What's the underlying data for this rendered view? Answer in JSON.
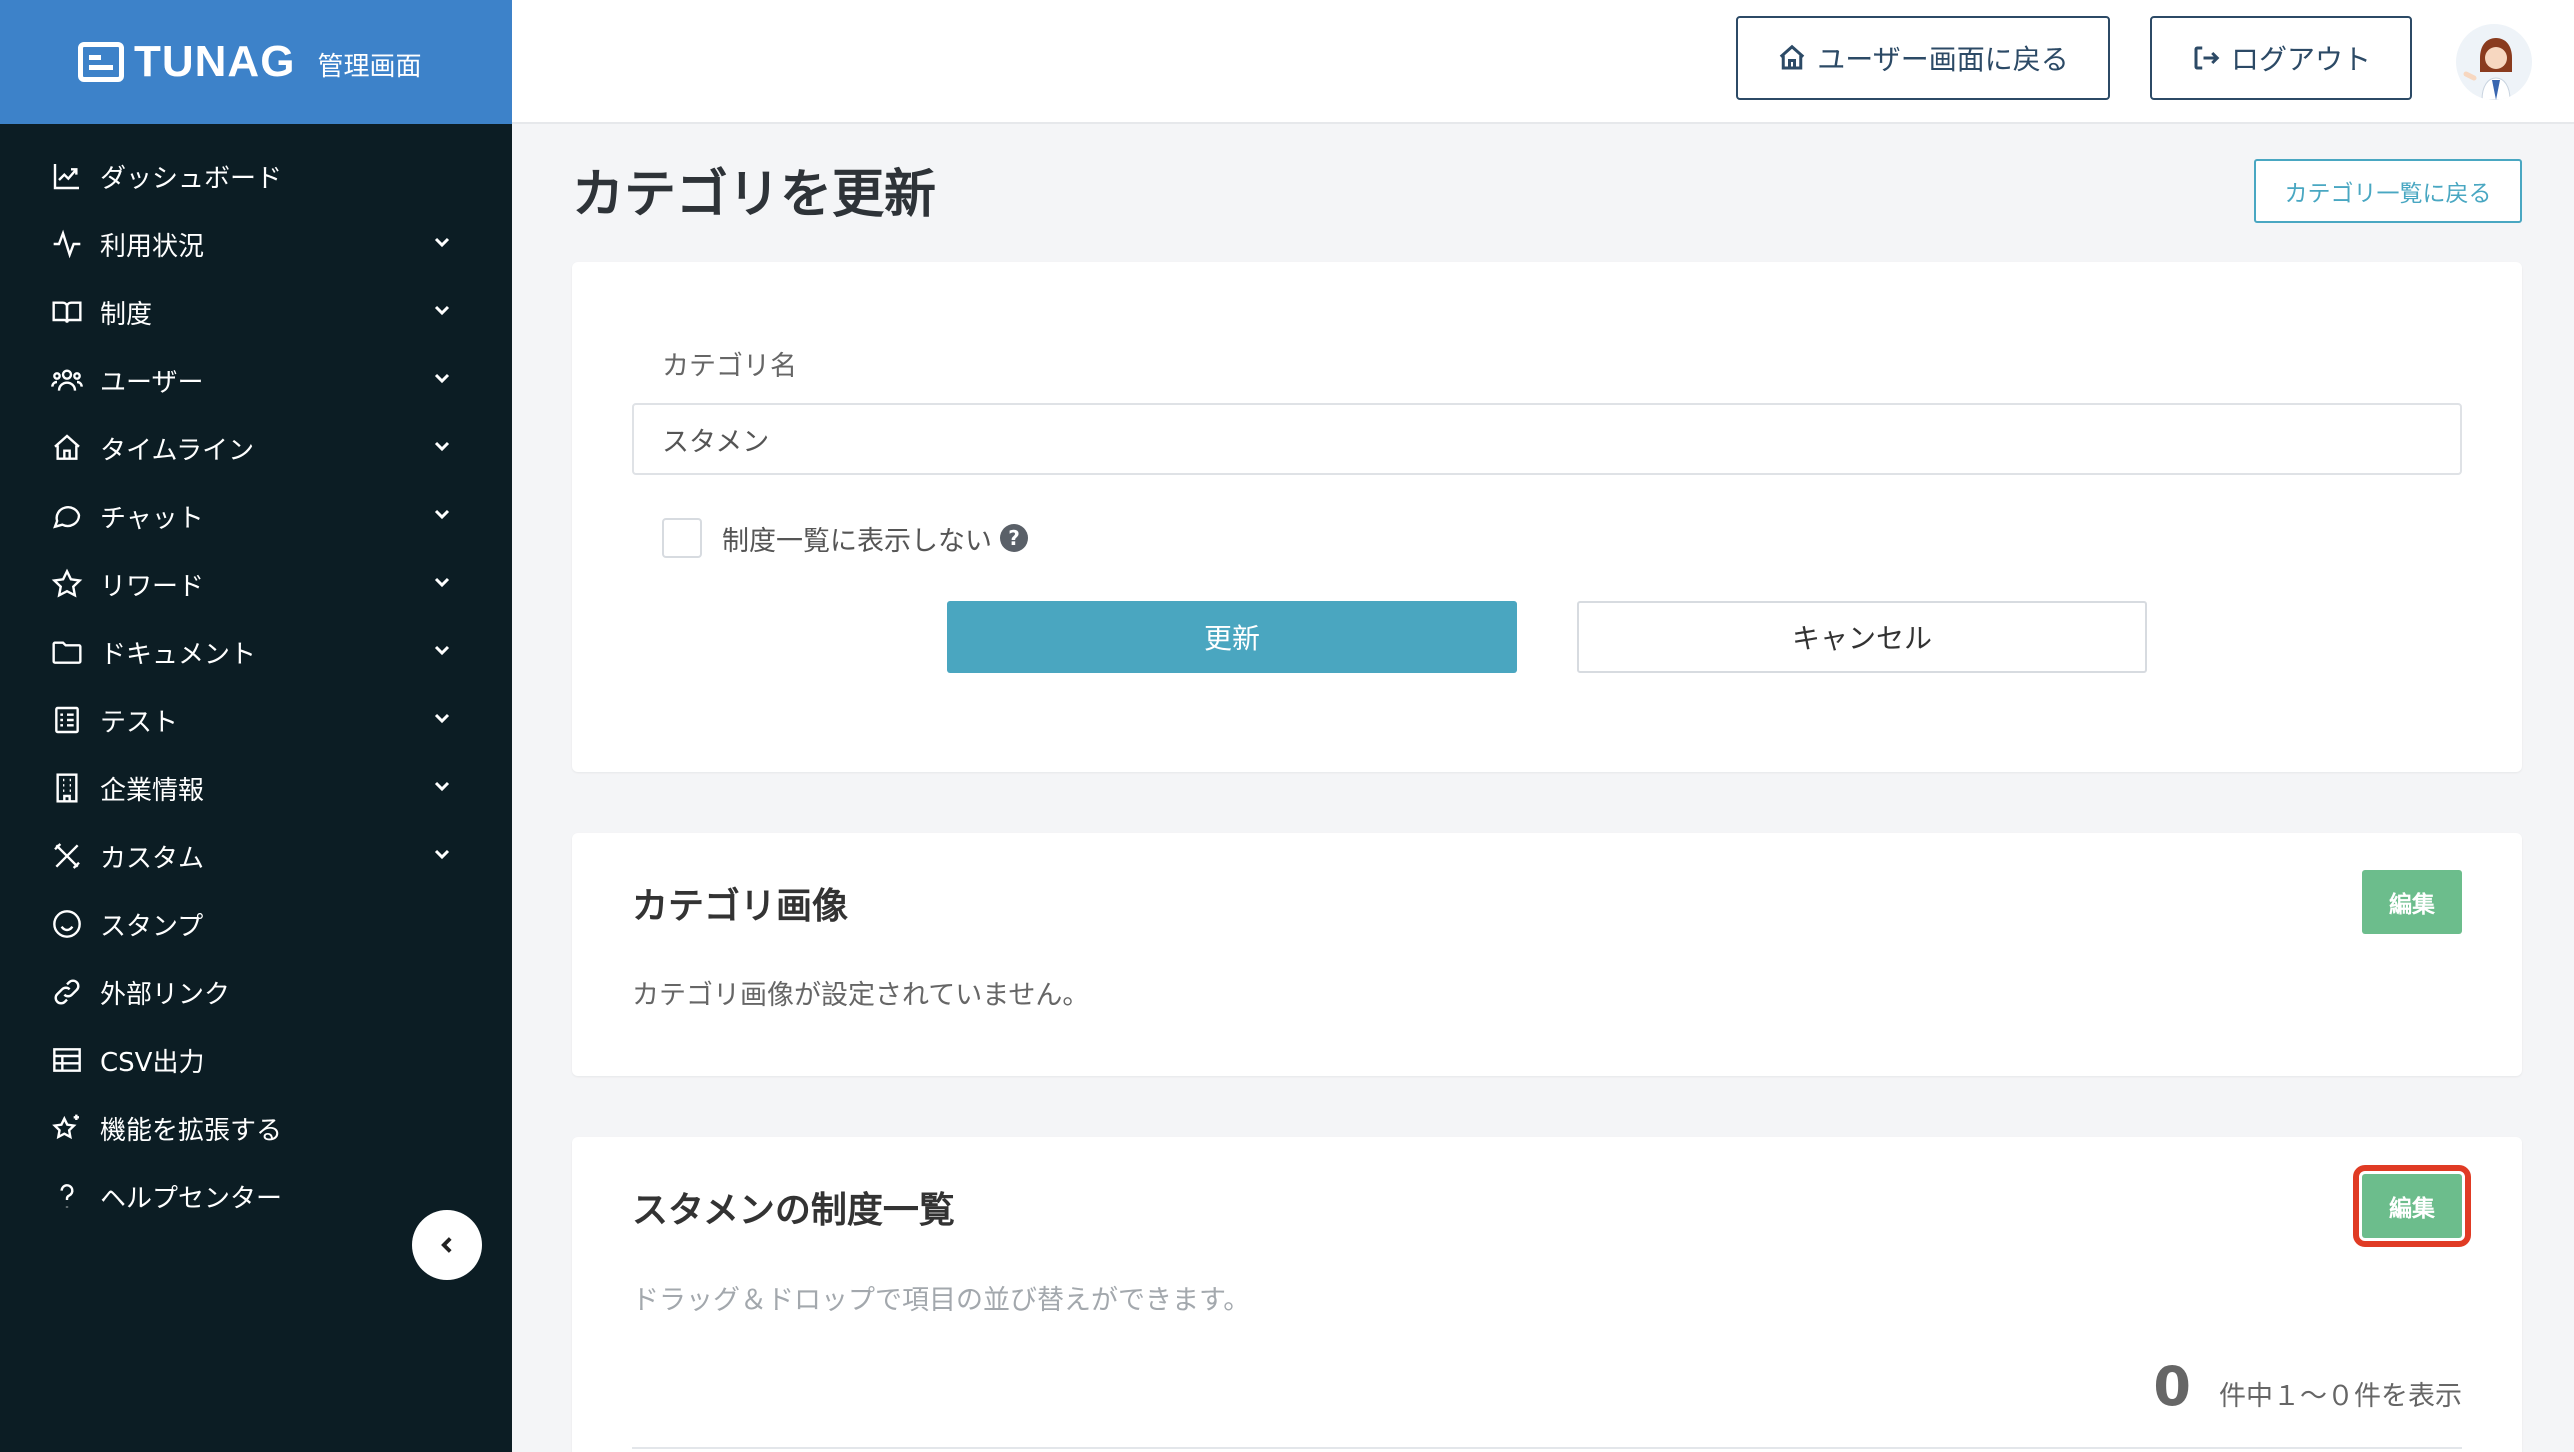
{
  "app": {
    "logo": "TUNAG",
    "subtitle": "管理画面"
  },
  "sidebar": {
    "items": [
      {
        "label": "ダッシュボード",
        "icon": "chart-line-icon",
        "expandable": false
      },
      {
        "label": "利用状況",
        "icon": "activity-icon",
        "expandable": true
      },
      {
        "label": "制度",
        "icon": "book-icon",
        "expandable": true
      },
      {
        "label": "ユーザー",
        "icon": "users-icon",
        "expandable": true
      },
      {
        "label": "タイムライン",
        "icon": "home-icon",
        "expandable": true
      },
      {
        "label": "チャット",
        "icon": "chat-bubble-icon",
        "expandable": true
      },
      {
        "label": "リワード",
        "icon": "star-icon",
        "expandable": true
      },
      {
        "label": "ドキュメント",
        "icon": "folder-icon",
        "expandable": true
      },
      {
        "label": "テスト",
        "icon": "checklist-icon",
        "expandable": true
      },
      {
        "label": "企業情報",
        "icon": "building-icon",
        "expandable": true
      },
      {
        "label": "カスタム",
        "icon": "tools-icon",
        "expandable": true
      },
      {
        "label": "スタンプ",
        "icon": "smiley-icon",
        "expandable": false
      },
      {
        "label": "外部リンク",
        "icon": "link-icon",
        "expandable": false
      },
      {
        "label": "CSV出力",
        "icon": "table-icon",
        "expandable": false
      },
      {
        "label": "機能を拡張する",
        "icon": "sparkle-star-icon",
        "expandable": false
      },
      {
        "label": "ヘルプセンター",
        "icon": "question-icon",
        "expandable": false
      }
    ]
  },
  "header": {
    "user_screen_label": "ユーザー画面に戻る",
    "logout_label": "ログアウト"
  },
  "page": {
    "title": "カテゴリを更新",
    "back_to_list_label": "カテゴリ一覧に戻る"
  },
  "form": {
    "name_label": "カテゴリ名",
    "name_value": "スタメン",
    "hide_checkbox_label": "制度一覧に表示しない",
    "hide_checked": false,
    "submit_label": "更新",
    "cancel_label": "キャンセル"
  },
  "image_section": {
    "title": "カテゴリ画像",
    "edit_label": "編集",
    "empty_message": "カテゴリ画像が設定されていません。"
  },
  "systems_section": {
    "title": "スタメンの制度一覧",
    "edit_label": "編集",
    "hint": "ドラッグ＆ドロップで項目の並び替えができます。",
    "count": "0",
    "count_suffix": "件中１〜０件を表示"
  },
  "colors": {
    "logo_bar": "#3d82c9",
    "sidebar_bg": "#0c1d24",
    "primary": "#4aa6c0",
    "edit_green": "#6cbd8c",
    "highlight_red": "#e03b24",
    "header_btn": "#2c4a66"
  }
}
